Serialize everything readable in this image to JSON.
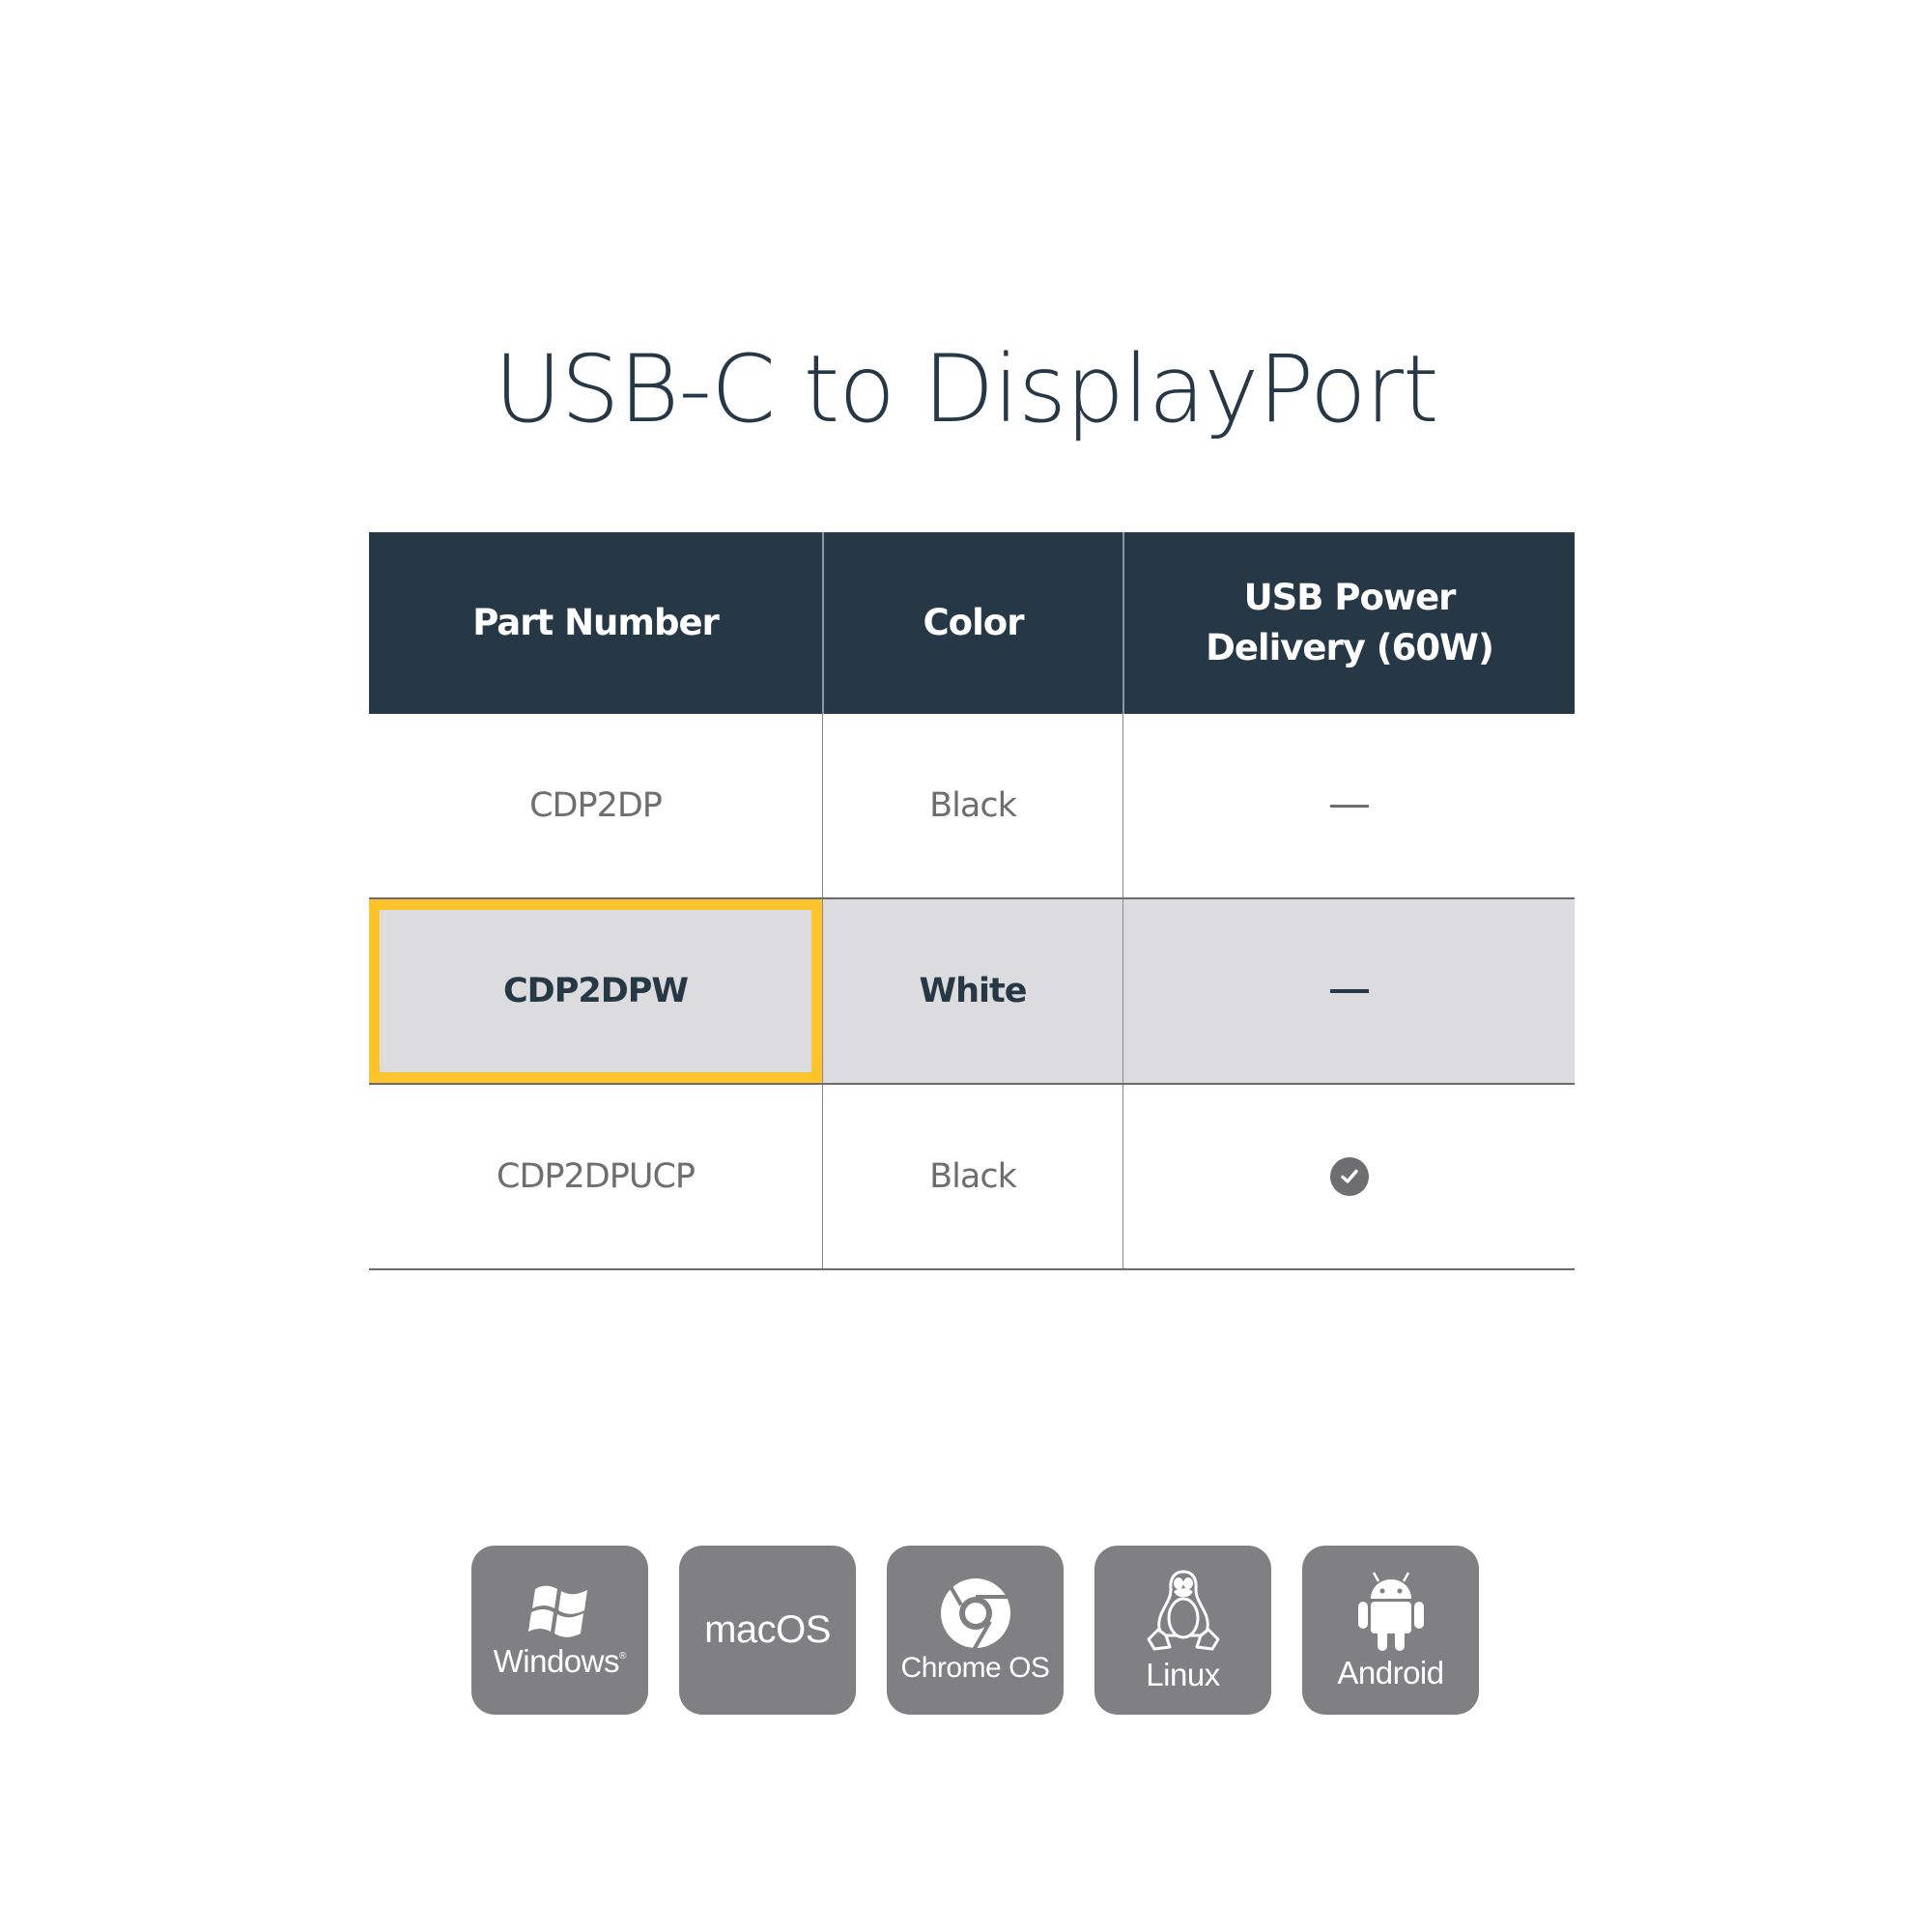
{
  "title": "USB-C to DisplayPort",
  "table": {
    "headers": [
      "Part Number",
      "Color",
      "USB Power Delivery (60W)"
    ],
    "rows": [
      {
        "part_number": "CDP2DP",
        "color": "Black",
        "usb_pd": "—",
        "usb_pd_icon": "dash-icon",
        "highlighted": false
      },
      {
        "part_number": "CDP2DPW",
        "color": "White",
        "usb_pd": "—",
        "usb_pd_icon": "dash-icon",
        "highlighted": true
      },
      {
        "part_number": "CDP2DPUCP",
        "color": "Black",
        "usb_pd": "✔",
        "usb_pd_icon": "check-circle-icon",
        "highlighted": false
      }
    ]
  },
  "os_compatibility": [
    {
      "name": "Windows",
      "icon": "windows-logo-icon",
      "trademark": "®"
    },
    {
      "name": "macOS",
      "icon": "none"
    },
    {
      "name": "Chrome OS",
      "icon": "chrome-logo-icon"
    },
    {
      "name": "Linux",
      "icon": "tux-penguin-icon"
    },
    {
      "name": "Android",
      "icon": "android-robot-icon"
    }
  ],
  "colors": {
    "header_bg": "#263746",
    "highlight_border": "#fcc42a",
    "highlight_bg": "#dcdcde",
    "tile_bg": "#808083",
    "body_text": "#6e6e70"
  }
}
